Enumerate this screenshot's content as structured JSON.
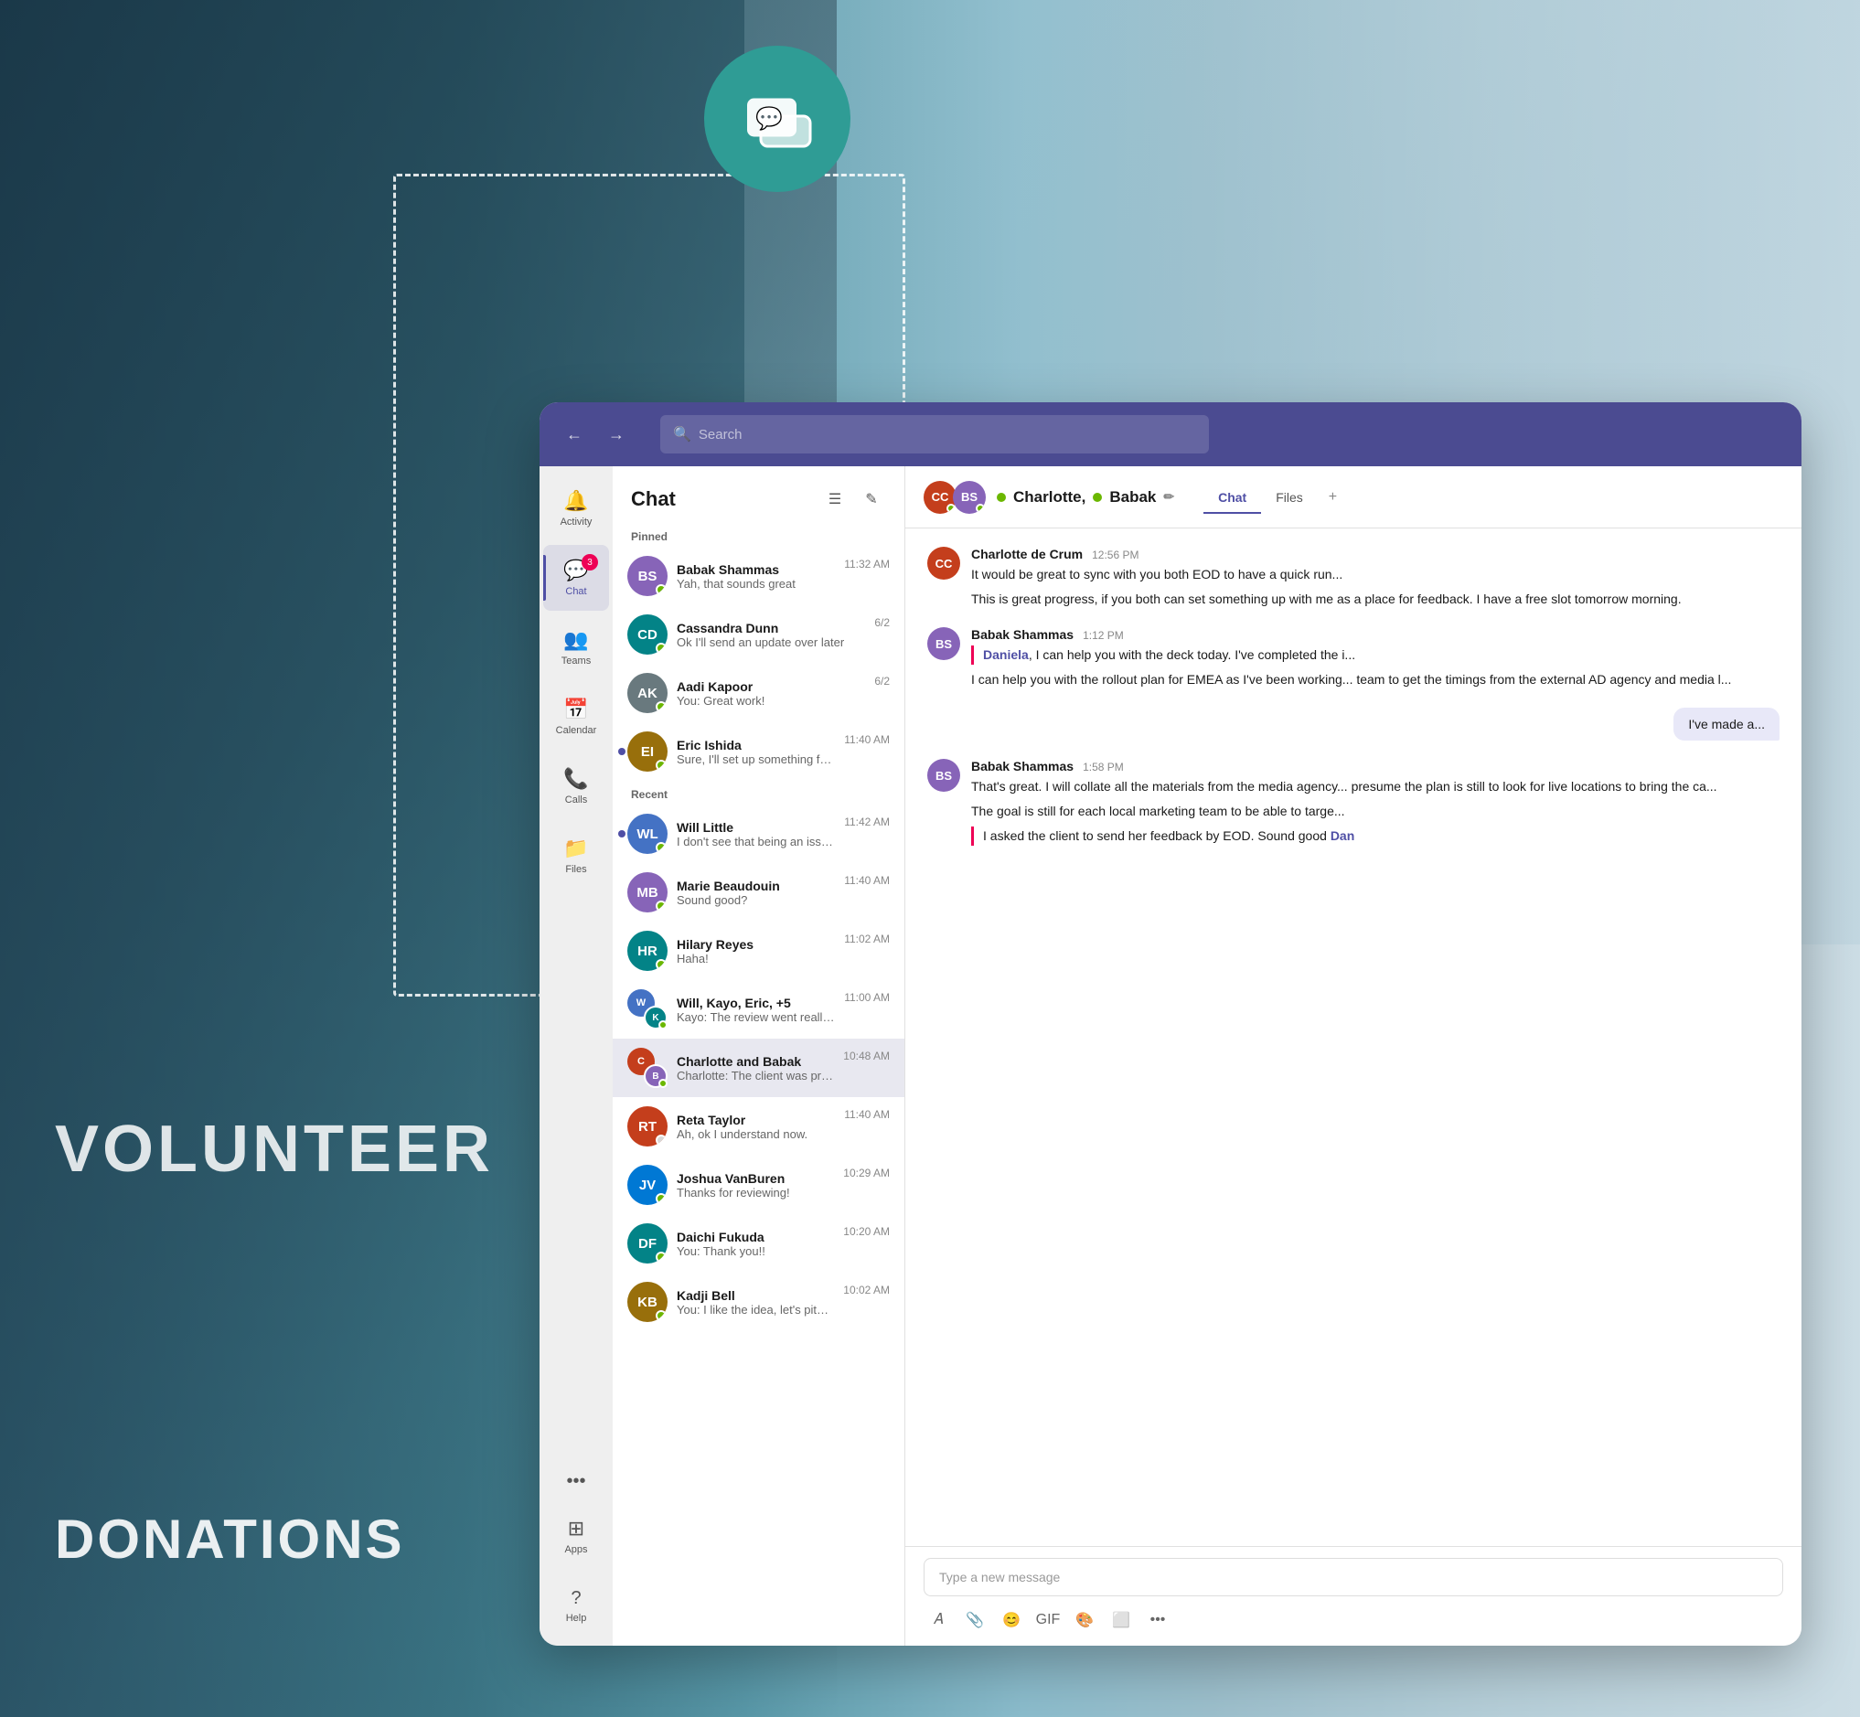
{
  "background": {
    "volunteer_text": "VOLUNTEER",
    "donations_text": "DONATIONS"
  },
  "topbar": {
    "search_placeholder": "Search"
  },
  "sidebar": {
    "items": [
      {
        "id": "activity",
        "label": "Activity",
        "icon": "🔔",
        "badge": null
      },
      {
        "id": "chat",
        "label": "Chat",
        "icon": "💬",
        "badge": "3",
        "active": true
      },
      {
        "id": "teams",
        "label": "Teams",
        "icon": "👥",
        "badge": null
      },
      {
        "id": "calendar",
        "label": "Calendar",
        "icon": "📅",
        "badge": null
      },
      {
        "id": "calls",
        "label": "Calls",
        "icon": "📞",
        "badge": null
      },
      {
        "id": "files",
        "label": "Files",
        "icon": "📁",
        "badge": null
      }
    ],
    "more_label": "...",
    "apps_label": "Apps",
    "help_label": "Help"
  },
  "chat_list": {
    "title": "Chat",
    "pinned_label": "Pinned",
    "recent_label": "Recent",
    "conversations": [
      {
        "id": "babak",
        "name": "Babak Shammas",
        "preview": "Yah, that sounds great",
        "time": "11:32 AM",
        "pinned": true,
        "status": "green",
        "avatar_color": "av-babak",
        "initials": "BS"
      },
      {
        "id": "cassandra",
        "name": "Cassandra Dunn",
        "preview": "Ok I'll send an update over later",
        "time": "6/2",
        "pinned": true,
        "status": "green",
        "avatar_color": "av-cassandra",
        "initials": "CD"
      },
      {
        "id": "aadi",
        "name": "Aadi Kapoor",
        "preview": "You: Great work!",
        "time": "6/2",
        "pinned": true,
        "status": "green",
        "avatar_color": "av-aadi",
        "initials": "AK"
      },
      {
        "id": "eric",
        "name": "Eric Ishida",
        "preview": "Sure, I'll set up something for next week to...",
        "time": "11:40 AM",
        "pinned": true,
        "status": "green",
        "avatar_color": "av-eric",
        "initials": "EI",
        "unread": true
      },
      {
        "id": "will",
        "name": "Will Little",
        "preview": "I don't see that being an issue, can take t...",
        "time": "11:42 AM",
        "pinned": false,
        "status": "green",
        "avatar_color": "av-will",
        "initials": "WL",
        "unread": true
      },
      {
        "id": "marie",
        "name": "Marie Beaudouin",
        "preview": "Sound good?",
        "time": "11:40 AM",
        "pinned": false,
        "status": "green",
        "avatar_color": "av-mb",
        "initials": "MB"
      },
      {
        "id": "hilary",
        "name": "Hilary Reyes",
        "preview": "Haha!",
        "time": "11:02 AM",
        "pinned": false,
        "status": "green",
        "avatar_color": "av-hilary",
        "initials": "HR"
      },
      {
        "id": "will-group",
        "name": "Will, Kayo, Eric, +5",
        "preview": "Kayo: The review went really well! Can't wai...",
        "time": "11:00 AM",
        "pinned": false,
        "status": "green",
        "avatar_color": "av-will",
        "initials": "WK",
        "is_group": true
      },
      {
        "id": "charlotte-babak",
        "name": "Charlotte and Babak",
        "preview": "Charlotte: The client was pretty happy with...",
        "time": "10:48 AM",
        "pinned": false,
        "status": "green",
        "avatar_color": "av-charlotte",
        "initials": "CB",
        "active": true,
        "is_group": true
      },
      {
        "id": "reta",
        "name": "Reta Taylor",
        "preview": "Ah, ok I understand now.",
        "time": "11:40 AM",
        "pinned": false,
        "status": "away",
        "avatar_color": "av-reta",
        "initials": "RT"
      },
      {
        "id": "joshua",
        "name": "Joshua VanBuren",
        "preview": "Thanks for reviewing!",
        "time": "10:29 AM",
        "pinned": false,
        "status": "green",
        "avatar_color": "av-joshua",
        "initials": "JV"
      },
      {
        "id": "daichi",
        "name": "Daichi Fukuda",
        "preview": "You: Thank you!!",
        "time": "10:20 AM",
        "pinned": false,
        "status": "green",
        "avatar_color": "av-daichi",
        "initials": "DF"
      },
      {
        "id": "kadji",
        "name": "Kadji Bell",
        "preview": "You: I like the idea, let's pitch it!",
        "time": "10:02 AM",
        "pinned": false,
        "status": "green",
        "avatar_color": "av-kadji",
        "initials": "KB"
      }
    ]
  },
  "chat_main": {
    "header": {
      "names": "Charlotte, Babak",
      "edit_icon": "✏",
      "tabs": [
        "Chat",
        "Files"
      ],
      "active_tab": "Chat",
      "add_tab": "+"
    },
    "messages": [
      {
        "id": "msg1",
        "sender": "Charlotte de Crum",
        "time": "12:56 PM",
        "avatar_color": "av-charlotte",
        "initials": "CC",
        "text": "It would be great to sync with you both EOD to have a quick run...",
        "text2": "This is great progress, if you both can set something up with me as a place for feedback. I have a free slot tomorrow morning.",
        "important": false
      },
      {
        "id": "msg2",
        "sender": "Babak Shammas",
        "time": "1:12 PM",
        "avatar_color": "av-babak",
        "initials": "BS",
        "mention": "Daniela",
        "text": ", I can help you with the deck today. I've completed the i...",
        "text2": "I can help you with the rollout plan for EMEA as I've been working... team to get the timings from the external AD agency and media l...",
        "important": true
      },
      {
        "id": "msg3-self",
        "self": true,
        "text": "I've made a..."
      },
      {
        "id": "msg4",
        "sender": "Babak Shammas",
        "time": "1:58 PM",
        "avatar_color": "av-babak",
        "initials": "BS",
        "text": "That's great. I will collate all the materials from the media agency... presume the plan is still to look for live locations to bring the ca...",
        "text2": "The goal is still for each local marketing team to be able to targe...",
        "text3_mention": "Dan",
        "text3_before": "I asked the client to send her feedback by EOD. Sound good ",
        "important": true
      }
    ],
    "input_placeholder": "Type a new message"
  }
}
